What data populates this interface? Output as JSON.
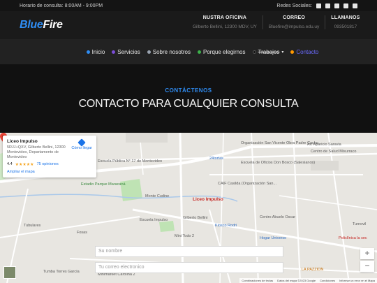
{
  "topbar": {
    "hours": "Horario de consulta:  8:00AM - 9:00PM",
    "social_label": "Redes Sociales:",
    "social_icons": [
      "facebook-icon",
      "twitter-icon",
      "linkedin-icon",
      "instagram-icon",
      "youtube-icon"
    ]
  },
  "header": {
    "logo_blue": "Blue",
    "logo_white": "Fire",
    "columns": [
      {
        "heading": "NUSTRA OFICINA",
        "value": "Gilberto Bellini, 12300 MDV, UY"
      },
      {
        "heading": "CORREO",
        "value": "Bluefire@impulso.edu.uy"
      },
      {
        "heading": "LLAMANOS",
        "value": "093501817"
      }
    ]
  },
  "nav": {
    "items": [
      {
        "label": "Inicio",
        "color": "#2f8df4"
      },
      {
        "label": "Servicios",
        "color": "#7b4dd6"
      },
      {
        "label": "Sobre nosotros",
        "color": "#9aa4b0"
      },
      {
        "label": "Porque elegirnos",
        "color": "#3cb04a"
      },
      {
        "label": "Trabajos",
        "color": "#111111"
      },
      {
        "label": "Contacto",
        "color": "#ff9800"
      }
    ]
  },
  "hero": {
    "kicker": "CONTÁCTENOS",
    "title": "CONTACTO PARA CUALQUIER CONSULTA"
  },
  "map": {
    "place_name": "Liceo Impulso",
    "place_address": "5RJJ+QXV, Gilberto Bellini, 12300 Montevideo, Departamento de Montevideo",
    "rating": "4.4",
    "stars": "★★★★★",
    "reviews": "75 opiniones",
    "enlarge": "Ampliar el mapa",
    "directions": "Cómo llegar",
    "marker_label": "Liceo Impulso",
    "labels": {
      "estadio": "Estadio Parque Maracaná",
      "monte_cudine": "Monte Cudine",
      "escuela": "Escuela Impulso",
      "kiosco": "Kiosco Rodri",
      "caif": "CAIF Casilda (Organización San...",
      "organizacion": "Organización San Vicente Obra Padre Cacho",
      "centro_salud": "Centro de Salud Misurraco",
      "escuela_oficios": "Escuela de Oficios Don Bosco (Salesianos)",
      "centro_oscar": "Centro Abuelo Oscar",
      "hogar": "Hogar Universo",
      "policlinica": "Policlínica la sec",
      "tubulares": "Tubulares",
      "fosas": "Fosas",
      "mini_todo": "Mini Todo 2",
      "minimarket": "Minimarket Carolina 2",
      "pazzion": "LA PAZZION",
      "tumba": "Tumba Torres García",
      "escuela_17": "Escuela Pública N° 17 de Montevideo",
      "gilberto": "Gilberto Bellini",
      "ave_aparicio": "Av. Aparicio Saravia",
      "tortas": "24tortas",
      "turnovil": "Turnovil"
    },
    "attribution": [
      "Combinaciones de teclas",
      "Datos del mapa ©2023 Google",
      "Condiciones",
      "Informar un error en el Mapa"
    ],
    "zoom_in": "+",
    "zoom_out": "−"
  },
  "form": {
    "name_placeholder": "Su nombre",
    "email_placeholder": "Tu correo electronico"
  }
}
